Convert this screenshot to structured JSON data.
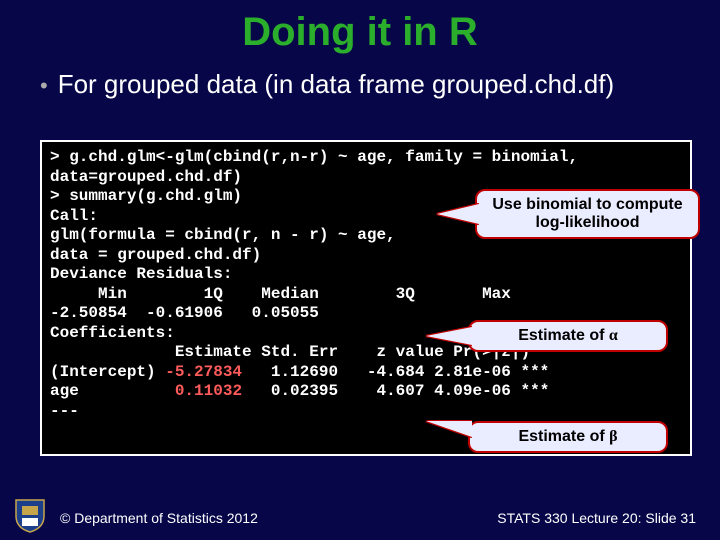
{
  "title": "Doing it in R",
  "bullet": "For grouped data (in data frame grouped.chd.df)",
  "code": {
    "l1": "> g.chd.glm<-glm(cbind(r,n-r) ~ age, family = binomial,",
    "l2": "data=grouped.chd.df)",
    "l3": "> summary(g.chd.glm)",
    "l4": "Call:",
    "l5": "glm(formula = cbind(r, n - r) ~ age,",
    "l6": "data = grouped.chd.df)",
    "l7": "Deviance Residuals:",
    "l8": "     Min        1Q    Median        3Q       Max",
    "l9": "-2.50854  -0.61906   0.05055",
    "l10": "Coefficients:",
    "l11": "             Estimate Std. Err    z value Pr(>|z|)",
    "l12a": "(Intercept) ",
    "l12b": "-5.27834",
    "l12c": "   1.12690   -4.684 2.81e-06 ***",
    "l13a": "age          ",
    "l13b": "0.11032",
    "l13c": "   0.02395    4.607 4.09e-06 ***",
    "l14": "---"
  },
  "callouts": {
    "c1a": "Use binomial to compute",
    "c1b": "log-likelihood",
    "c2": "Estimate of ",
    "c2sym": "α",
    "c3": "Estimate of ",
    "c3sym": "β"
  },
  "footer": {
    "left": "© Department of Statistics 2012",
    "right": "STATS 330 Lecture 20: Slide 31"
  }
}
